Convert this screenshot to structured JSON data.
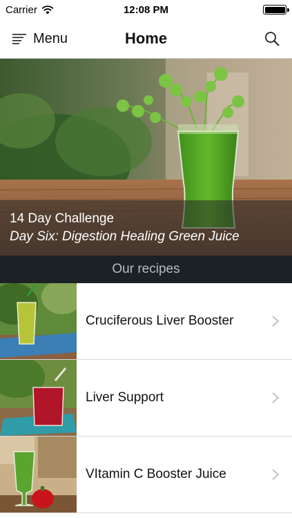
{
  "status_bar": {
    "carrier": "Carrier",
    "time": "12:08 PM",
    "icons": [
      "wifi-icon",
      "battery-icon"
    ]
  },
  "nav": {
    "menu_label": "Menu",
    "title": "Home",
    "menu_icon": "hamburger-icon",
    "search_icon": "search-icon"
  },
  "hero": {
    "title": "14 Day Challenge",
    "subtitle": "Day Six: Digestion Healing Green Juice"
  },
  "section": {
    "title": "Our recipes"
  },
  "recipes": [
    {
      "name": "Cruciferous Liver Booster",
      "juice_color": "#b7c43a"
    },
    {
      "name": "Liver Support",
      "juice_color": "#b0152a"
    },
    {
      "name": "VItamin C Booster Juice",
      "juice_color": "#5aa52e"
    }
  ],
  "colors": {
    "section_header_bg": "#1c2126",
    "section_header_text": "#b9bdc0",
    "chevron": "#c7c7cc"
  }
}
